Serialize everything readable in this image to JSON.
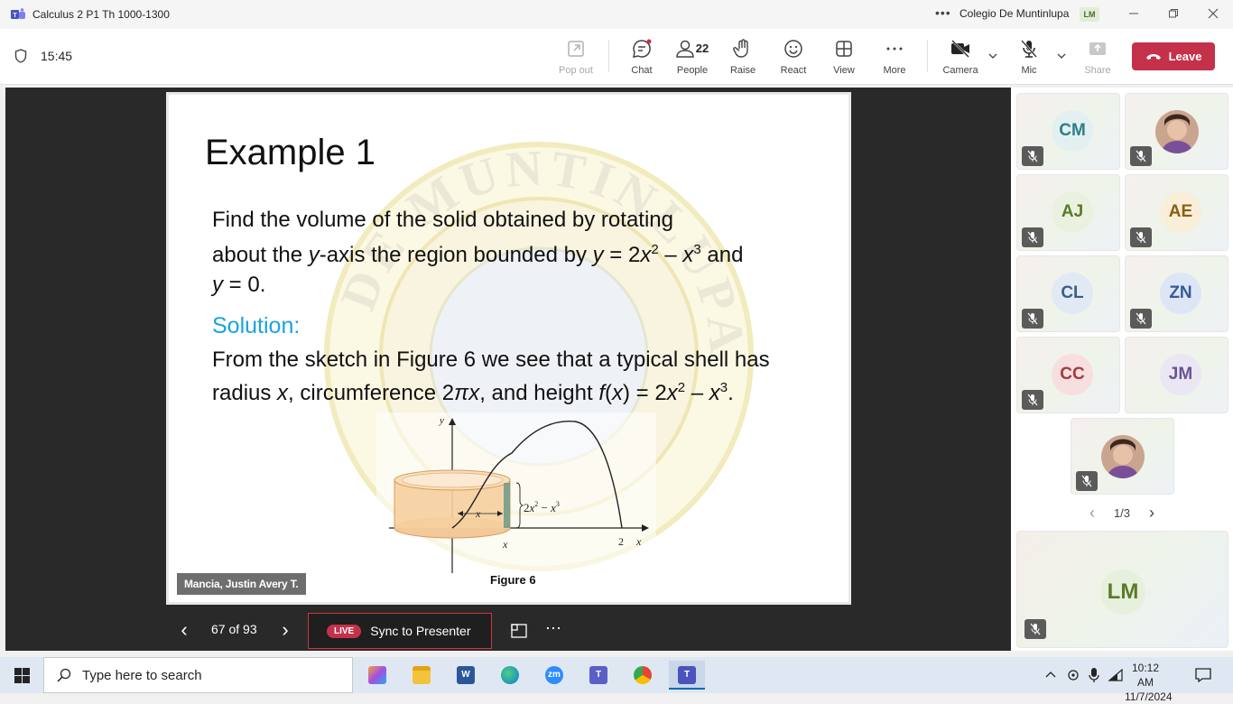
{
  "window": {
    "title": "Calculus 2 P1 Th 1000-1300",
    "more": "•••",
    "org": "Colegio De Muntinlupa",
    "org_badge": "LM"
  },
  "toolbar": {
    "timer": "15:45",
    "popout": "Pop out",
    "chat": "Chat",
    "people": "People",
    "people_count": "22",
    "raise": "Raise",
    "react": "React",
    "view": "View",
    "more": "More",
    "camera": "Camera",
    "mic": "Mic",
    "share": "Share",
    "leave": "Leave"
  },
  "slide": {
    "title": "Example 1",
    "p1": "Find the volume of the solid obtained by rotating",
    "p2a": "about the ",
    "p2b": "y",
    "p2c": "-axis the region bounded by ",
    "p2d": "y",
    "p2e": " = 2",
    "p2f": "x",
    "p2g": "2",
    "p2h": " – ",
    "p2i": "x",
    "p2j": "3",
    "p2k": " and",
    "p3a": "y",
    "p3b": " = 0.",
    "solution": "Solution:",
    "s1": "From the sketch in Figure 6 we see that a typical shell has",
    "s2a": "radius ",
    "s2b": "x",
    "s2c": ", circumference 2",
    "s2d": "πx",
    "s2e": ", and height ",
    "s2f": "f",
    "s2g": "(",
    "s2h": "x",
    "s2i": ") = 2",
    "s2j": "x",
    "s2k": "2",
    "s2l": " – ",
    "s2m": "x",
    "s2n": "3",
    "s2o": ".",
    "fig_y": "y",
    "fig_x": "x",
    "fig_2": "2",
    "fig_x2": "x",
    "fig_xr": "x",
    "fig_h1": "2",
    "fig_h2": "x",
    "fig_h3": "2",
    "fig_h4": " − ",
    "fig_h5": "x",
    "fig_h6": "3",
    "caption": "Figure 6",
    "seal_text": "DE MUNTINLUPA"
  },
  "presenter": {
    "name": "Mancia, Justin Avery T."
  },
  "controls": {
    "prev": "‹",
    "next": "›",
    "page": "67 of 93",
    "live": "LIVE",
    "sync": "Sync to Presenter",
    "more": "⋯"
  },
  "participants": [
    {
      "initials": "CM",
      "bg": "#e3f0f1",
      "fg": "#2f7e86"
    },
    {
      "initials": "",
      "photo": true
    },
    {
      "initials": "AJ",
      "bg": "#eaf2df",
      "fg": "#5a7a2a"
    },
    {
      "initials": "AE",
      "bg": "#f9eed7",
      "fg": "#8a5d14"
    },
    {
      "initials": "CL",
      "bg": "#e1e9f4",
      "fg": "#3d5d86"
    },
    {
      "initials": "ZN",
      "bg": "#dde6f6",
      "fg": "#345a9a"
    },
    {
      "initials": "CC",
      "bg": "#f7dfe0",
      "fg": "#a23b40"
    },
    {
      "initials": "JM",
      "bg": "#ebe6f3",
      "fg": "#6a5591"
    },
    {
      "initials": "",
      "photo": true
    }
  ],
  "pager": {
    "prev": "‹",
    "page": "1/3",
    "next": "›"
  },
  "self_view": {
    "initials": "LM",
    "bg": "#e6f0dc",
    "fg": "#5a7a2a"
  },
  "taskbar": {
    "search_placeholder": "Type here to search",
    "time": "10:12 AM",
    "date": "11/7/2024",
    "zoom_label": "zm"
  }
}
